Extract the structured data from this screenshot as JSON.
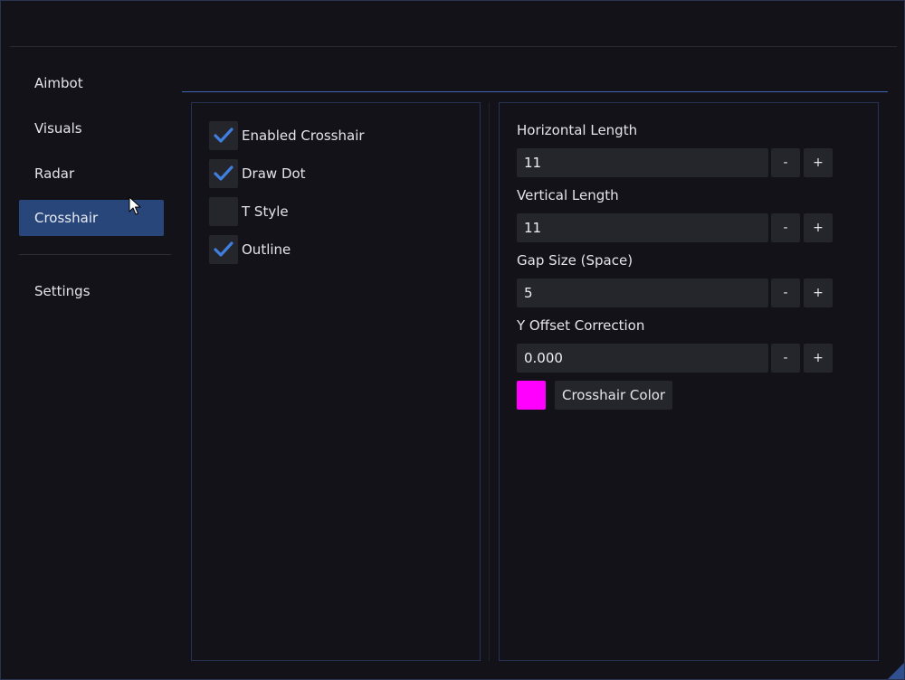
{
  "sidebar": {
    "items": [
      {
        "label": "Aimbot"
      },
      {
        "label": "Visuals"
      },
      {
        "label": "Radar"
      },
      {
        "label": "Crosshair",
        "active": true
      },
      {
        "label": "Settings"
      }
    ]
  },
  "crosshair": {
    "checkboxes": [
      {
        "label": "Enabled Crosshair",
        "checked": true
      },
      {
        "label": "Draw Dot",
        "checked": true
      },
      {
        "label": "T Style",
        "checked": false
      },
      {
        "label": "Outline",
        "checked": true
      }
    ],
    "fields": [
      {
        "label": "Horizontal Length",
        "value": "11"
      },
      {
        "label": "Vertical Length",
        "value": "11"
      },
      {
        "label": "Gap Size (Space)",
        "value": "5"
      },
      {
        "label": "Y Offset Correction",
        "value": "0.000"
      }
    ],
    "stepper": {
      "minus": "-",
      "plus": "+"
    },
    "color": {
      "label": "Crosshair Color",
      "value": "#ff00ff"
    }
  },
  "theme": {
    "accent": "#3e66b5",
    "active_bg": "#29467a",
    "check_color": "#3f7fe0",
    "panel_border": "#273356"
  }
}
